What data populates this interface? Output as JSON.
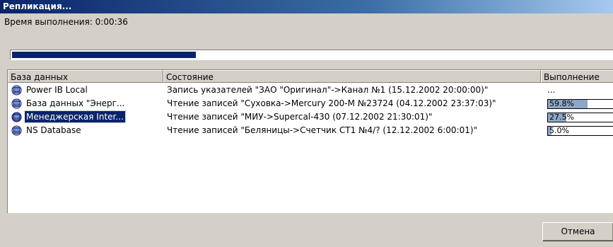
{
  "window": {
    "title": "Репликация..."
  },
  "elapsed": {
    "text": "Время выполнения: 0:00:36"
  },
  "overall_progress": {
    "fraction": 0.31
  },
  "table": {
    "columns": [
      "База данных",
      "Состояние",
      "Выполнение"
    ],
    "rows": [
      {
        "name": "Power IB Local",
        "status": "Запись указателей \"ЗАО \"Оригинал\"->Канал №1 (15.12.2002 20:00:00)\"",
        "progress_text": "...",
        "progress": null,
        "selected": false
      },
      {
        "name": "База данных \"Энерг...",
        "status": "Чтение записей \"Суховка->Mercury 200-M №23724 (04.12.2002 23:37:03)\"",
        "progress_text": "59.8%",
        "progress": 0.598,
        "selected": false
      },
      {
        "name": "Менеджерская Inter...",
        "status": "Чтение записей \"МИУ->Supercal-430 (07.12.2002 21:30:01)\"",
        "progress_text": "27.5%",
        "progress": 0.275,
        "selected": true
      },
      {
        "name": "NS Database",
        "status": "Чтение записей \"Беляницы->Счетчик СТ1 №4/? (12.12.2002 6:00:01)\"",
        "progress_text": "5.0%",
        "progress": 0.05,
        "selected": false
      }
    ]
  },
  "buttons": {
    "cancel": "Отмена"
  },
  "colors": {
    "selection": "#0a246a",
    "progress_fill": "#0a246a",
    "row_bar_fill": "#8fa6c8"
  },
  "icons": {
    "database": "database-icon"
  }
}
